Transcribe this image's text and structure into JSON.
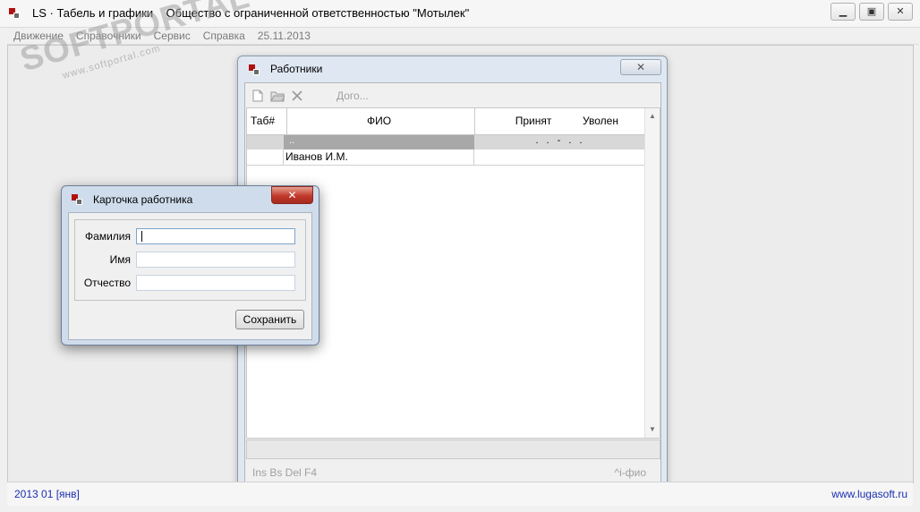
{
  "app": {
    "title": "LS · Табель и графики    Общество с ограниченной ответственностью \"Мотылек\""
  },
  "menu": {
    "items": [
      "Движение",
      "Справочники",
      "Сервис",
      "Справка",
      "25.11.2013"
    ]
  },
  "watermark": {
    "brand": "SOFTPORTAL",
    "url": "www.softportal.com"
  },
  "workers": {
    "title": "Работники",
    "toolbar": {
      "icons": [
        "new-document-icon",
        "open-folder-icon",
        "delete-x-icon"
      ],
      "text": "Дого..."
    },
    "columns": [
      "Таб#",
      "ФИО",
      "Принят",
      "Уволен"
    ],
    "selected_row": {
      "fio": "..",
      "dates": ". .  -  . ."
    },
    "rows": [
      {
        "tab": "",
        "fio": "Иванов И.М.",
        "start": "",
        "end": ""
      }
    ],
    "footer_hints": "Ins Bs Del  F4",
    "footer_right": "^i-фио"
  },
  "card": {
    "title": "Карточка работника",
    "labels": {
      "last_name": "Фамилия",
      "first_name": "Имя",
      "patronymic": "Отчество"
    },
    "values": {
      "last_name": "",
      "first_name": "",
      "patronymic": ""
    },
    "save_label": "Сохранить"
  },
  "status": {
    "period": "2013 01 [янв]",
    "site": "www.lugasoft.ru"
  },
  "colors": {
    "status_text": "#1a2fb0",
    "close_red": "#c0392b"
  }
}
